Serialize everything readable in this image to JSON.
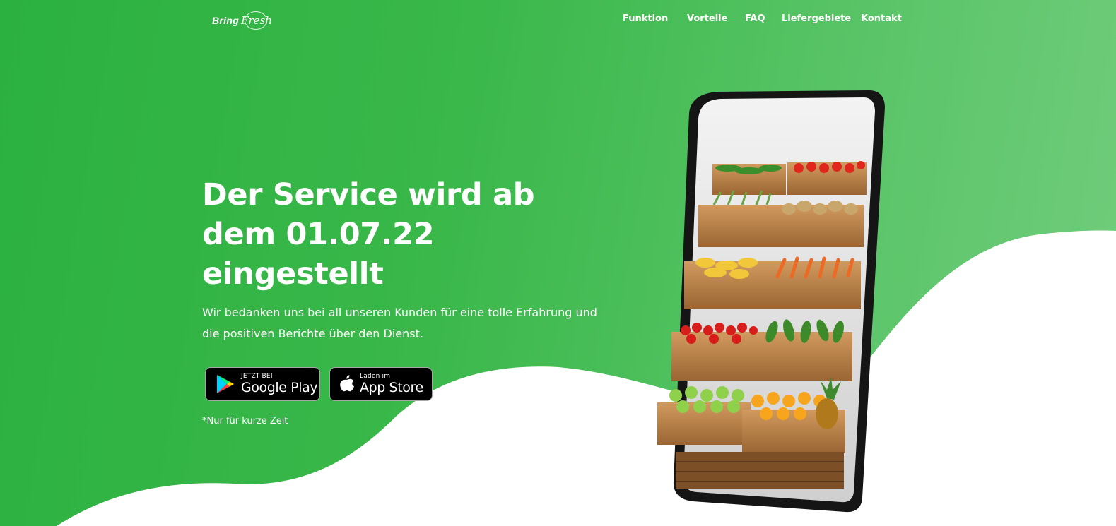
{
  "brand": {
    "logo_word1": "Bring",
    "logo_word2": "Fresh"
  },
  "nav": {
    "items": [
      "Funktion",
      "Vorteile",
      "FAQ",
      "Liefergebiete",
      "Kontakt"
    ]
  },
  "hero": {
    "title_lines": [
      "Der Service wird ab",
      "dem 01.07.22",
      "eingestellt"
    ],
    "subtitle_lines": [
      "Wir bedanken uns bei all unseren Kunden für eine tolle Erfahrung und",
      "die positiven Berichte über den Dienst."
    ],
    "note": "*Nur für kurze Zeit"
  },
  "stores": {
    "google": {
      "small": "JETZT BEI",
      "big": "Google Play"
    },
    "apple": {
      "small": "Laden im",
      "big": "App Store"
    }
  },
  "colors": {
    "green_start": "#2bb140",
    "green_end": "#72cd7c",
    "white": "#ffffff"
  },
  "icons": [
    "google-play-icon",
    "apple-icon",
    "phone-illustration"
  ]
}
